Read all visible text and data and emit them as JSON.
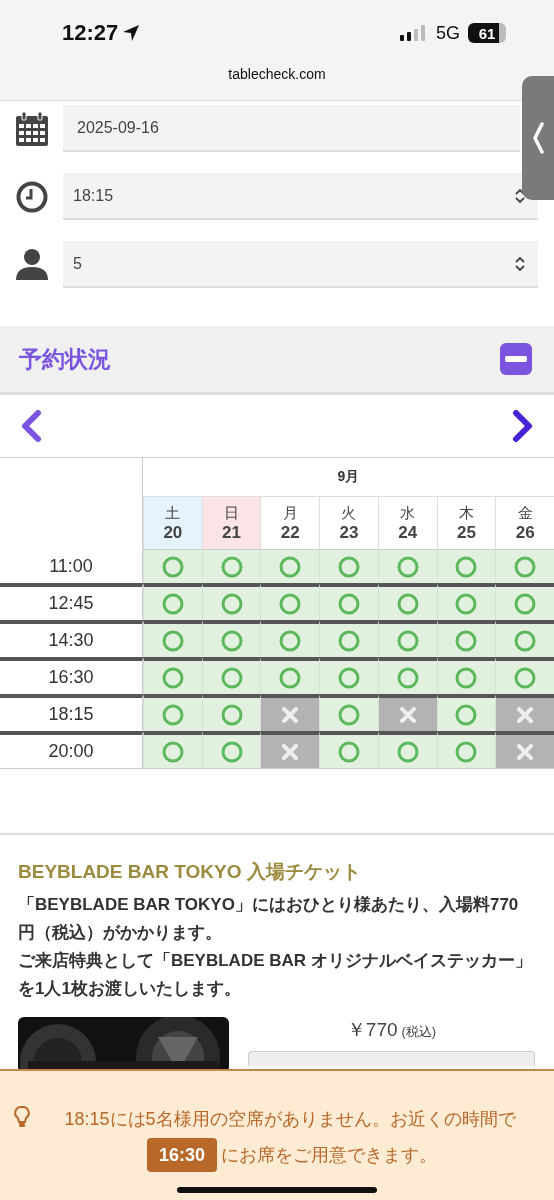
{
  "status_bar": {
    "time": "12:27",
    "network": "5G",
    "battery": "61"
  },
  "browser": {
    "url": "tablecheck.com"
  },
  "form": [
    {
      "kind": "date",
      "value": "2025-09-16"
    },
    {
      "kind": "time",
      "value": "18:15"
    },
    {
      "kind": "party",
      "value": "5"
    }
  ],
  "availability": {
    "title": "予約状況",
    "expanded": true,
    "month": "9月",
    "days": [
      {
        "weekday": "土",
        "day": "20",
        "kind": "sat"
      },
      {
        "weekday": "日",
        "day": "21",
        "kind": "sun"
      },
      {
        "weekday": "月",
        "day": "22",
        "kind": "weekday"
      },
      {
        "weekday": "火",
        "day": "23",
        "kind": "weekday"
      },
      {
        "weekday": "水",
        "day": "24",
        "kind": "weekday"
      },
      {
        "weekday": "木",
        "day": "25",
        "kind": "weekday"
      },
      {
        "weekday": "金",
        "day": "26",
        "kind": "weekday"
      }
    ],
    "rows": [
      {
        "time": "11:00",
        "slots": [
          true,
          true,
          true,
          true,
          true,
          true,
          true
        ]
      },
      {
        "time": "12:45",
        "slots": [
          true,
          true,
          true,
          true,
          true,
          true,
          true
        ]
      },
      {
        "time": "14:30",
        "slots": [
          true,
          true,
          true,
          true,
          true,
          true,
          true
        ]
      },
      {
        "time": "16:30",
        "slots": [
          true,
          true,
          true,
          true,
          true,
          true,
          true
        ]
      },
      {
        "time": "18:15",
        "slots": [
          true,
          true,
          false,
          true,
          false,
          true,
          false
        ]
      },
      {
        "time": "20:00",
        "slots": [
          true,
          true,
          false,
          true,
          true,
          true,
          false
        ]
      }
    ]
  },
  "ticket": {
    "title": "BEYBLADE BAR TOKYO 入場チケット",
    "description": [
      "「BEYBLADE BAR TOKYO」にはおひとり様あたり、入場料770円（税込）がかかります。",
      "ご来店特典として「BEYBLADE BAR オリジナルベイステッカー」を1人1枚お渡しいたします。"
    ],
    "price": "￥770",
    "tax_note": "(税込)"
  },
  "notice": {
    "before": "18:15には5名様用の空席がありません。お近くの時間で",
    "suggested_time": "16:30",
    "after": "にお席をご用意できます。"
  }
}
